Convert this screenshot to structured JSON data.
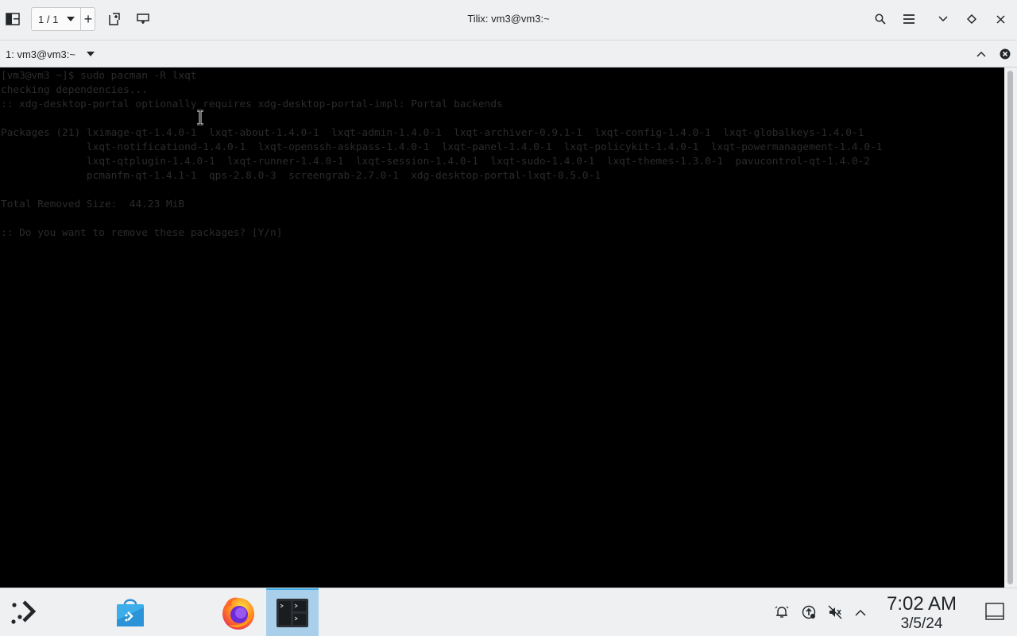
{
  "window": {
    "title": "Tilix: vm3@vm3:~",
    "session_count": "1 / 1"
  },
  "terminal": {
    "tab_title": "1: vm3@vm3:~",
    "lines": [
      "[vm3@vm3 ~]$ sudo pacman -R lxqt",
      "checking dependencies...",
      ":: xdg-desktop-portal optionally requires xdg-desktop-portal-impl: Portal backends",
      "",
      "Packages (21) lximage-qt-1.4.0-1  lxqt-about-1.4.0-1  lxqt-admin-1.4.0-1  lxqt-archiver-0.9.1-1  lxqt-config-1.4.0-1  lxqt-globalkeys-1.4.0-1",
      "              lxqt-notificationd-1.4.0-1  lxqt-openssh-askpass-1.4.0-1  lxqt-panel-1.4.0-1  lxqt-policykit-1.4.0-1  lxqt-powermanagement-1.4.0-1",
      "              lxqt-qtplugin-1.4.0-1  lxqt-runner-1.4.0-1  lxqt-session-1.4.0-1  lxqt-sudo-1.4.0-1  lxqt-themes-1.3.0-1  pavucontrol-qt-1.4.0-2",
      "              pcmanfm-qt-1.4.1-1  qps-2.8.0-3  screengrab-2.7.0-1  xdg-desktop-portal-lxqt-0.5.0-1",
      "",
      "Total Removed Size:  44.23 MiB",
      "",
      ":: Do you want to remove these packages? [Y/n]"
    ]
  },
  "taskbar": {
    "clock_time": "7:02 AM",
    "clock_date": "3/5/24",
    "apps": [
      "application-launcher",
      "discover",
      "firefox",
      "tilix"
    ],
    "accent": "#3daee9"
  }
}
